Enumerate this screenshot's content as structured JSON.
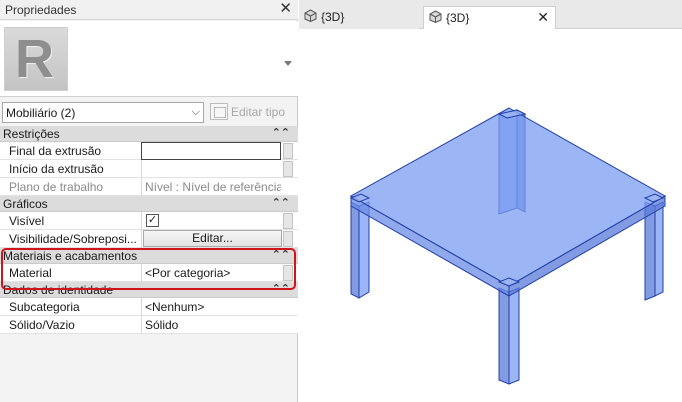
{
  "properties_panel": {
    "title": "Propriedades",
    "type_selector": {
      "value": "Mobiliário (2)"
    },
    "edit_type_label": "Editar tipo",
    "sections": [
      {
        "title": "Restrições",
        "rows": [
          {
            "name": "Final da extrusão",
            "value": ""
          },
          {
            "name": "Início da extrusão",
            "value": ""
          },
          {
            "name": "Plano de trabalho",
            "value": "Nível : Nível de referência"
          }
        ]
      },
      {
        "title": "Gráficos",
        "rows": [
          {
            "name": "Visível",
            "checked": true
          },
          {
            "name": "Visibilidade/Sobreposi...",
            "button_label": "Editar..."
          }
        ]
      },
      {
        "title": "Materiais e acabamentos",
        "rows": [
          {
            "name": "Material",
            "value": "<Por categoria>"
          }
        ]
      },
      {
        "title": "Dados de identidade",
        "rows": [
          {
            "name": "Subcategoria",
            "value": "<Nenhum>"
          },
          {
            "name": "Sólido/Vazio",
            "value": "Sólido"
          }
        ]
      }
    ]
  },
  "view_tabs": [
    {
      "label": "{3D}",
      "active": false
    },
    {
      "label": "{3D}",
      "active": true
    }
  ],
  "colors": {
    "highlight": "#d1141b",
    "table_fill": "#7b9cf0",
    "table_stroke": "#1f3fa8"
  }
}
